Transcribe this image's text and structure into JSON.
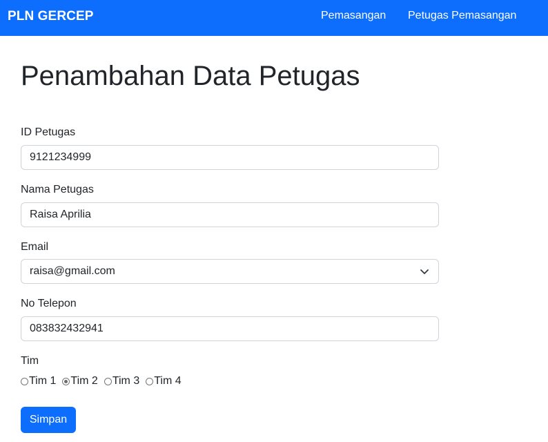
{
  "navbar": {
    "brand": "PLN GERCEP",
    "links": [
      "Pemasangan",
      "Petugas Pemasangan"
    ]
  },
  "page_title": "Penambahan Data Petugas",
  "form": {
    "id_label": "ID Petugas",
    "id_value": "9121234999",
    "name_label": "Nama Petugas",
    "name_value": "Raisa Aprilia",
    "email_label": "Email",
    "email_value": "raisa@gmail.com",
    "phone_label": "No Telepon",
    "phone_value": "083832432941",
    "team_label": "Tim",
    "team_options": [
      "Tim 1",
      "Tim 2",
      "Tim 3",
      "Tim 4"
    ],
    "team_selected": "Tim 2",
    "submit_label": "Simpan"
  },
  "colors": {
    "primary": "#0d6efd",
    "border": "#ced4da"
  }
}
